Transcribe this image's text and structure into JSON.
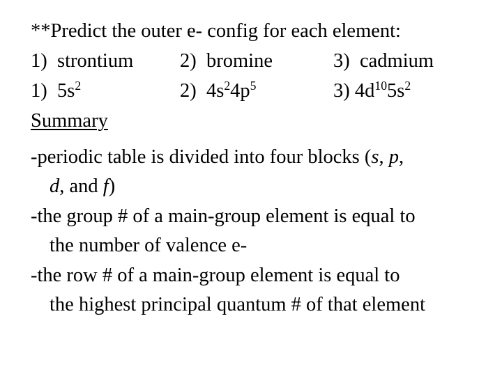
{
  "slide": {
    "prompt": "**Predict the outer e- config for each element:",
    "elements": [
      {
        "num": "1)",
        "name": "strontium"
      },
      {
        "num": "2)",
        "name": "bromine"
      },
      {
        "num": "3)",
        "name": "cadmium"
      }
    ],
    "answers": [
      {
        "num": "1)",
        "parts": [
          {
            "base": "5s",
            "sup": "2"
          }
        ]
      },
      {
        "num": "2)",
        "parts": [
          {
            "base": "4s",
            "sup": "2"
          },
          {
            "base": "4p",
            "sup": "5"
          }
        ]
      },
      {
        "num": "3)",
        "parts": [
          {
            "base": "4d",
            "sup": "10"
          },
          {
            "base": "5s",
            "sup": "2"
          }
        ]
      }
    ],
    "summary_heading": "Summary",
    "summary": {
      "point1_line1": "-periodic table is divided into four blocks  (",
      "point1_blocks": [
        "s",
        "p",
        "d",
        "f"
      ],
      "point1_sep1": ", ",
      "point1_sep2": ",",
      "point1_sep3": ", and ",
      "point1_close": ")",
      "point2_line1": "-the group # of a main-group element is equal to",
      "point2_line2": "the number of valence e-",
      "point3_line1": "-the row # of a main-group element is equal to",
      "point3_line2": "the highest principal quantum # of that element"
    }
  }
}
